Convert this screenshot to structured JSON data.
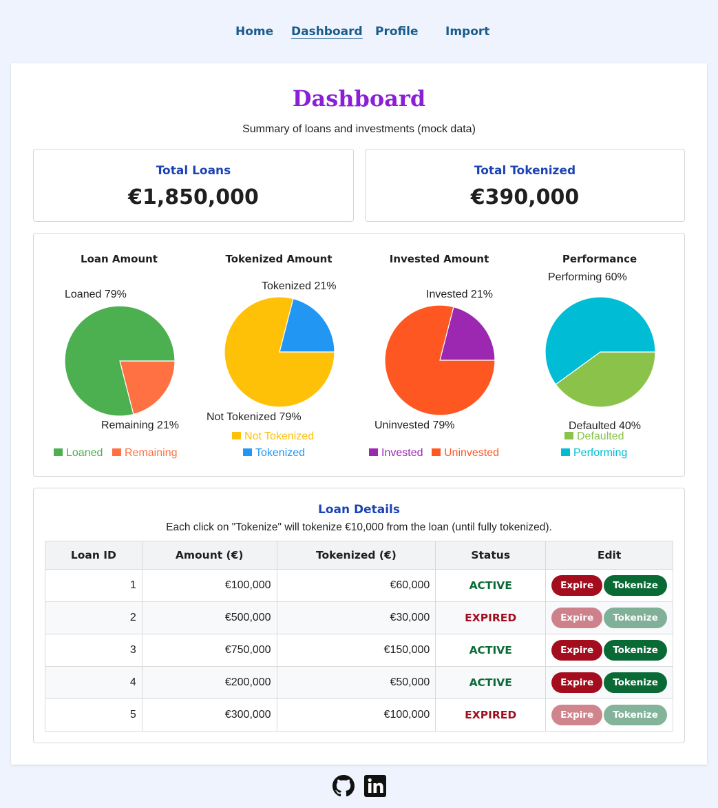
{
  "nav": {
    "home": "Home",
    "dashboard": "Dashboard",
    "profile": "Profile",
    "import": "Import"
  },
  "page": {
    "title": "Dashboard",
    "subtitle": "Summary of loans and investments (mock data)"
  },
  "stats": {
    "total_loans_label": "Total Loans",
    "total_loans_value": "€1,850,000",
    "total_tokenized_label": "Total Tokenized",
    "total_tokenized_value": "€390,000"
  },
  "colors": {
    "loaned": "#4caf50",
    "remaining": "#ff7043",
    "not_tokenized": "#ffc107",
    "tokenized": "#2196f3",
    "invested": "#9c27b0",
    "uninvested": "#ff5722",
    "performing": "#00bcd4",
    "defaulted": "#8bc34a"
  },
  "chart_data": [
    {
      "type": "pie",
      "title": "Loan Amount",
      "slices": [
        {
          "label": "Loaned",
          "value": 79,
          "display": "Loaned 79%",
          "color": "#4caf50"
        },
        {
          "label": "Remaining",
          "value": 21,
          "display": "Remaining 21%",
          "color": "#ff7043"
        }
      ],
      "legend": [
        "Loaned",
        "Remaining"
      ]
    },
    {
      "type": "pie",
      "title": "Tokenized Amount",
      "slices": [
        {
          "label": "Tokenized",
          "value": 21,
          "display": "Tokenized 21%",
          "color": "#2196f3"
        },
        {
          "label": "Not Tokenized",
          "value": 79,
          "display": "Not Tokenized 79%",
          "color": "#ffc107"
        }
      ],
      "legend": [
        "Not Tokenized",
        "Tokenized"
      ]
    },
    {
      "type": "pie",
      "title": "Invested Amount",
      "slices": [
        {
          "label": "Invested",
          "value": 21,
          "display": "Invested 21%",
          "color": "#9c27b0"
        },
        {
          "label": "Uninvested",
          "value": 79,
          "display": "Uninvested 79%",
          "color": "#ff5722"
        }
      ],
      "legend": [
        "Invested",
        "Uninvested"
      ]
    },
    {
      "type": "pie",
      "title": "Performance",
      "slices": [
        {
          "label": "Performing",
          "value": 60,
          "display": "Performing 60%",
          "color": "#00bcd4"
        },
        {
          "label": "Defaulted",
          "value": 40,
          "display": "Defaulted 40%",
          "color": "#8bc34a"
        }
      ],
      "legend": [
        "Defaulted",
        "Performing"
      ]
    }
  ],
  "loans": {
    "title": "Loan Details",
    "note": "Each click on \"Tokenize\" will tokenize €10,000 from the loan (until fully tokenized).",
    "columns": [
      "Loan ID",
      "Amount (€)",
      "Tokenized (€)",
      "Status",
      "Edit"
    ],
    "expire_label": "Expire",
    "tokenize_label": "Tokenize",
    "rows": [
      {
        "id": "1",
        "amount": "€100,000",
        "tokenized": "€60,000",
        "status": "ACTIVE"
      },
      {
        "id": "2",
        "amount": "€500,000",
        "tokenized": "€30,000",
        "status": "EXPIRED"
      },
      {
        "id": "3",
        "amount": "€750,000",
        "tokenized": "€150,000",
        "status": "ACTIVE"
      },
      {
        "id": "4",
        "amount": "€200,000",
        "tokenized": "€50,000",
        "status": "ACTIVE"
      },
      {
        "id": "5",
        "amount": "€300,000",
        "tokenized": "€100,000",
        "status": "EXPIRED"
      }
    ]
  },
  "footer": {
    "icons": [
      "github-icon",
      "linkedin-icon"
    ]
  }
}
